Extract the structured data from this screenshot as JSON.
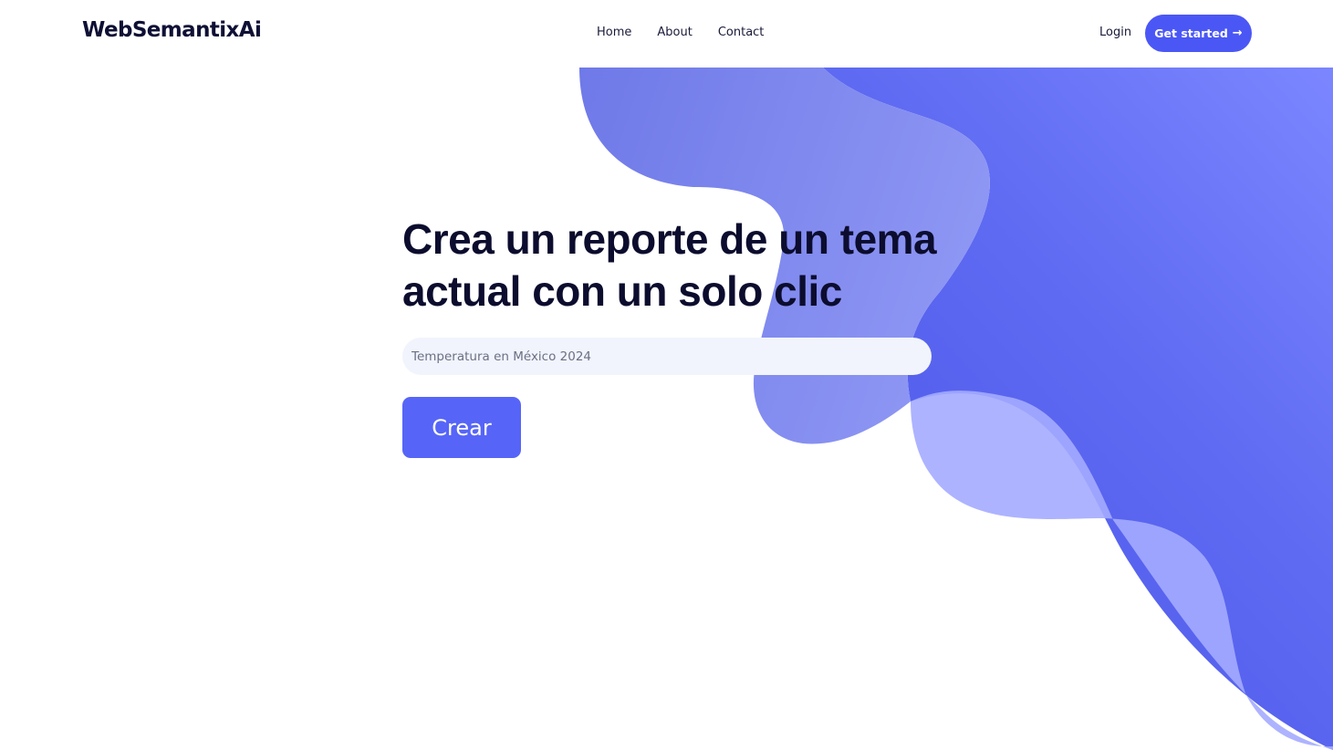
{
  "brand": {
    "name": "WebSemantixAi"
  },
  "nav": {
    "items": [
      {
        "label": "Home"
      },
      {
        "label": "About"
      },
      {
        "label": "Contact"
      }
    ]
  },
  "auth": {
    "login_label": "Login",
    "cta_label": "Get started",
    "cta_icon": "arrow-right-icon"
  },
  "hero": {
    "title_line1": "Crea un reporte de un tema",
    "title_line2": "actual con un solo clic",
    "input_placeholder": "Temperatura en México 2024",
    "input_value": "",
    "submit_label": "Crear"
  },
  "colors": {
    "accent": "#4b57f5",
    "button": "#5665f7",
    "text_dark": "#0c0d2e",
    "input_bg": "#f1f4fc"
  }
}
